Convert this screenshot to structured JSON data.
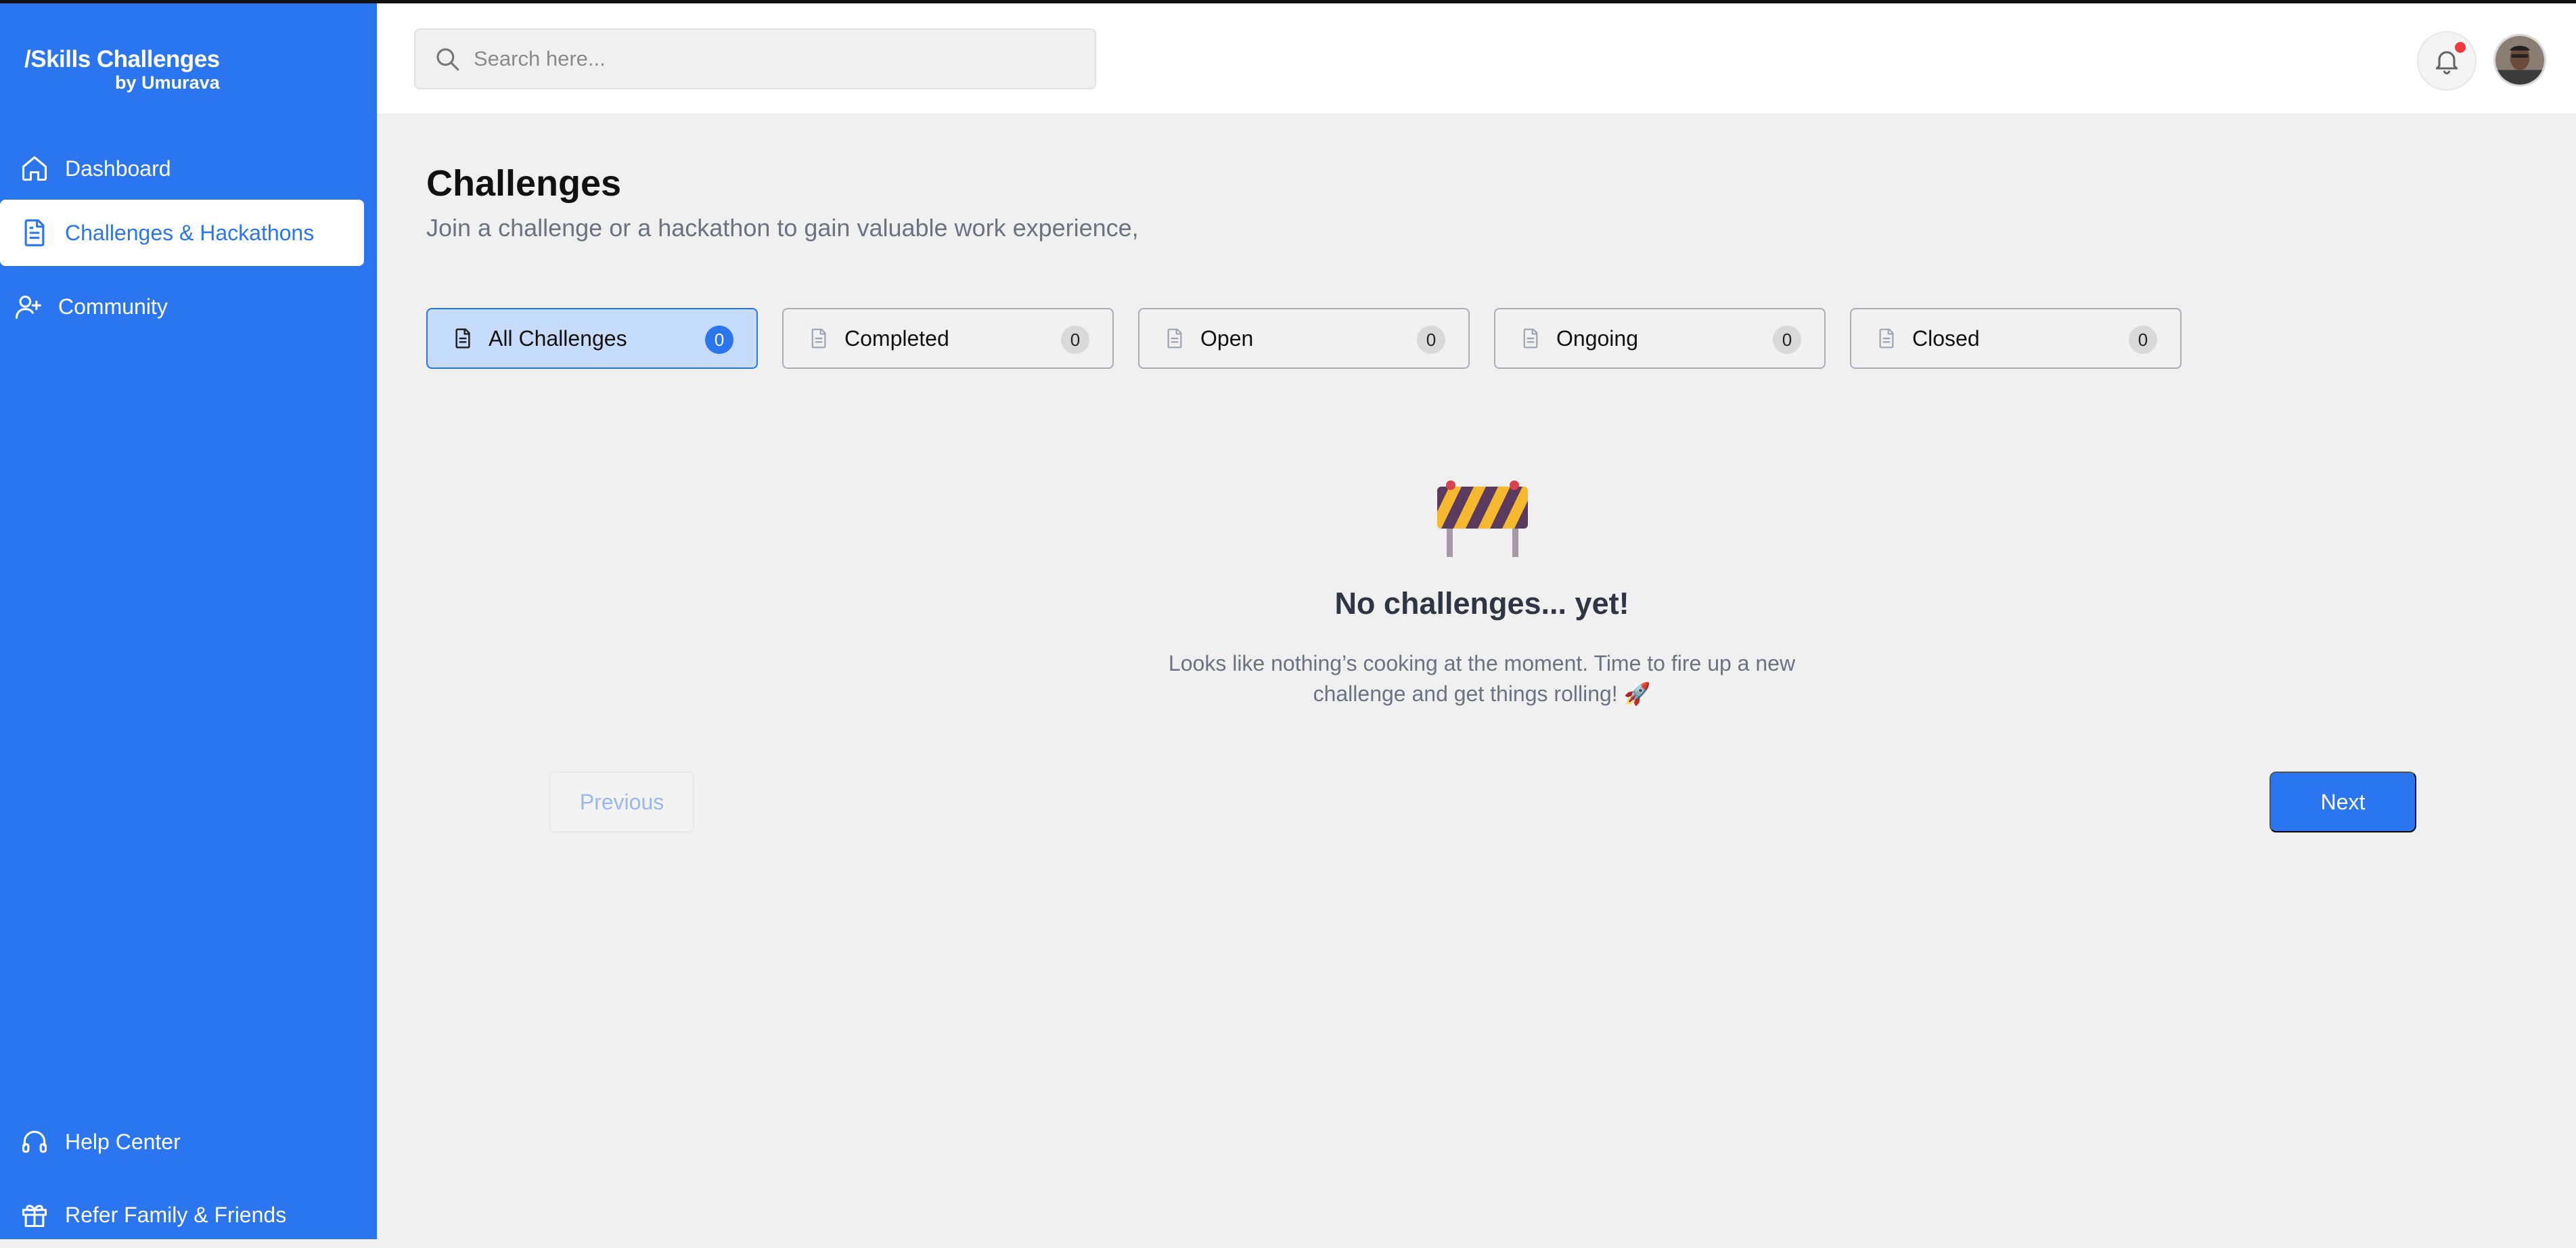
{
  "brand": {
    "line1": "/Skills Challenges",
    "line2": "by Umurava",
    "accent": "#2b75ee"
  },
  "sidebar": {
    "items": [
      {
        "label": "Dashboard",
        "icon": "home-icon"
      },
      {
        "label": "Challenges & Hackathons",
        "icon": "document-icon",
        "active": true
      },
      {
        "label": "Community",
        "icon": "user-plus-icon"
      }
    ],
    "bottom": [
      {
        "label": "Help Center",
        "icon": "headset-icon"
      },
      {
        "label": "Refer Family & Friends",
        "icon": "gift-icon"
      }
    ]
  },
  "header": {
    "search_placeholder": "Search here...",
    "notification_icon": "bell-icon",
    "notification_dot_color": "#ef3a3a"
  },
  "main": {
    "title": "Challenges",
    "subtitle": "Join a challenge or a hackathon to gain valuable work experience,",
    "tabs": [
      {
        "label": "All Challenges",
        "count": "0",
        "active": true
      },
      {
        "label": "Completed",
        "count": "0"
      },
      {
        "label": "Open",
        "count": "0"
      },
      {
        "label": "Ongoing",
        "count": "0"
      },
      {
        "label": "Closed",
        "count": "0"
      }
    ],
    "empty": {
      "icon": "construction-barrier-icon",
      "title": "No challenges... yet!",
      "text": "Looks like nothing’s cooking at the moment. Time to fire up a new challenge and get things rolling! 🚀"
    },
    "pagination": {
      "previous": "Previous",
      "next": "Next"
    }
  }
}
